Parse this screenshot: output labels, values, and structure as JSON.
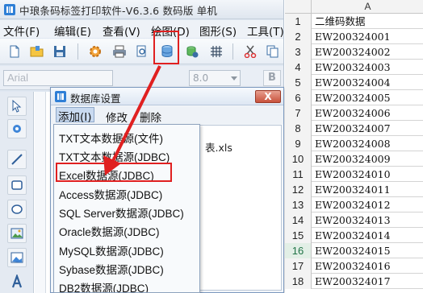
{
  "window": {
    "title": "中琅条码标签打印软件-V6.3.6 数码版 单机"
  },
  "menu": {
    "items": [
      "文件(F)",
      "编辑(E)",
      "查看(V)",
      "绘图(D)",
      "图形(S)",
      "工具(T)"
    ]
  },
  "format_bar": {
    "font_name": "Arial",
    "font_size": "8.0",
    "bold_label": "B"
  },
  "dialog": {
    "title": "数据库设置",
    "close_label": "X",
    "tabs": [
      "添加(I)",
      "修改",
      "删除"
    ],
    "background_row_text": "表.xls"
  },
  "dropdown": {
    "items": [
      "TXT文本数据源(文件)",
      "TXT文本数据源(JDBC)",
      "Excel数据源(JDBC)",
      "Access数据源(JDBC)",
      "SQL Server数据源(JDBC)",
      "Oracle数据源(JDBC)",
      "MySQL数据源(JDBC)",
      "Sybase数据源(JDBC)",
      "DB2数据源(JDBC)"
    ],
    "highlighted_index": 2
  },
  "sheet": {
    "column": "A",
    "rows": [
      {
        "num": "1",
        "value": "二维码数据"
      },
      {
        "num": "2",
        "value": "EW200324001"
      },
      {
        "num": "3",
        "value": "EW200324002"
      },
      {
        "num": "4",
        "value": "EW200324003"
      },
      {
        "num": "5",
        "value": "EW200324004"
      },
      {
        "num": "6",
        "value": "EW200324005"
      },
      {
        "num": "7",
        "value": "EW200324006"
      },
      {
        "num": "8",
        "value": "EW200324007"
      },
      {
        "num": "9",
        "value": "EW200324008"
      },
      {
        "num": "10",
        "value": "EW200324009"
      },
      {
        "num": "11",
        "value": "EW200324010"
      },
      {
        "num": "12",
        "value": "EW200324011"
      },
      {
        "num": "13",
        "value": "EW200324012"
      },
      {
        "num": "14",
        "value": "EW200324013"
      },
      {
        "num": "15",
        "value": "EW200324014"
      },
      {
        "num": "16",
        "value": "EW200324015"
      },
      {
        "num": "17",
        "value": "EW200324016"
      },
      {
        "num": "18",
        "value": "EW200324017"
      }
    ],
    "selected_row": "16"
  },
  "colors": {
    "highlight_red": "#e02020",
    "excel_green": "#217346"
  },
  "toolbar_icons": [
    "new-file-icon",
    "open-folder-icon",
    "save-icon",
    "settings-gear-icon",
    "print-icon",
    "print-preview-icon",
    "database-icon",
    "database-settings-icon",
    "grid-icon",
    "scissors-icon",
    "copy-icon"
  ],
  "tool_icons": [
    "pointer-icon",
    "rotate-icon",
    "line-icon",
    "rectangle-icon",
    "ellipse-icon",
    "image-icon",
    "picture-icon",
    "text-icon"
  ]
}
